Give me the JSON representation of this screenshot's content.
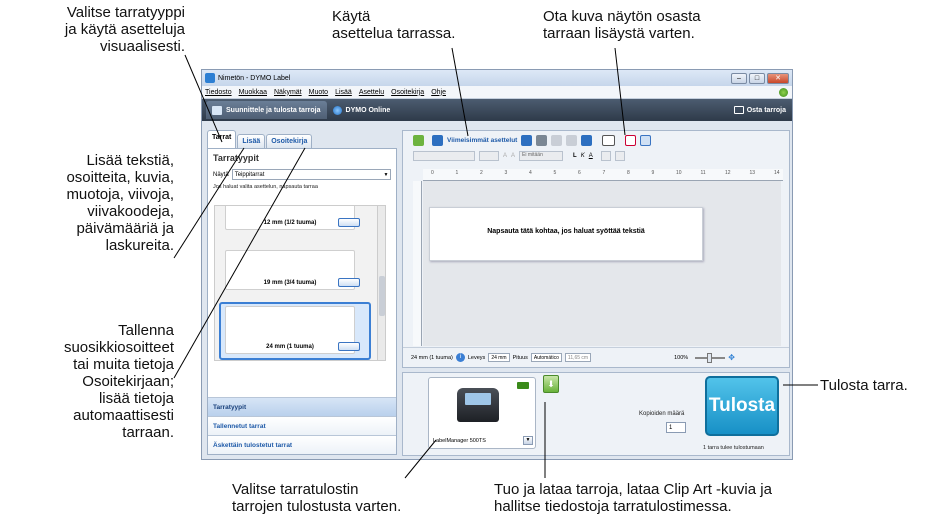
{
  "annotations": {
    "select_label_type": [
      "Valitse tarratyyppi",
      "ja käytä asetteluja",
      "visuaalisesti."
    ],
    "use_layout": [
      "Käytä",
      "asettelua tarrassa."
    ],
    "screen_capture": [
      "Ota kuva näytön osasta",
      "tarraan lisäystä varten."
    ],
    "insert_items": [
      "Lisää tekstiä,",
      "osoitteita, kuvia,",
      "muotoja, viivoja,",
      "viivakoodeja,",
      "päivämääriä ja",
      "laskureita."
    ],
    "save_addresses": [
      "Tallenna",
      "suosikkiosoitteet",
      "tai muita tietoja",
      "Osoitekirjaan;",
      "lisää tietoja",
      "automaattisesti",
      "tarraan."
    ],
    "print_label": [
      "Tulosta tarra."
    ],
    "select_printer": [
      "Valitse tarratulostin",
      "tarrojen tulostusta varten."
    ],
    "import_download": [
      "Tuo ja lataa tarroja, lataa Clip Art -kuvia ja",
      "hallitse tiedostoja tarratulostimessa."
    ]
  },
  "window": {
    "title": "Nimetön - DYMO Label",
    "menu": [
      "Tiedosto",
      "Muokkaa",
      "Näkymät",
      "Muoto",
      "Lisää",
      "Asettelu",
      "Osoitekirja",
      "Ohje"
    ],
    "app_tabs": [
      "Suunnittele ja tulosta tarroja",
      "DYMO Online"
    ],
    "buy_labels": "Osta tarroja"
  },
  "left_panel": {
    "tabs": [
      "Tarrat",
      "Lisää",
      "Osoitekirja"
    ],
    "heading": "Tarratyypit",
    "show_label": "Näytä",
    "show_value": "Teippitarrat",
    "hint": "Jos haluat valita asettelun, napsauta tarraa",
    "labels": [
      "12 mm (1/2 tuuma)",
      "19 mm (3/4 tuuma)",
      "24 mm (1 tuuma)"
    ],
    "sections": [
      "Tarratyypit",
      "Tallennetut tarrat",
      "Äskettäin tulostetut tarrat"
    ]
  },
  "editor": {
    "recent_layouts": "Viimeisimmät asettelut",
    "none_option": "Ei mitään",
    "ruler_ticks": [
      "0",
      "1",
      "2",
      "3",
      "4",
      "5",
      "6",
      "7",
      "8",
      "9",
      "10",
      "11",
      "12",
      "13",
      "14"
    ],
    "placeholder": "Napsauta tätä kohtaa, jos haluat syöttää tekstiä",
    "status": {
      "size": "24 mm (1 tuuma)",
      "width_label": "Leveys",
      "width_value": "24 mm",
      "length_label": "Pituus",
      "length_value": "Automático",
      "length_mm": "11,65 cm",
      "zoom": "100%"
    }
  },
  "bottom": {
    "printer": "LabelManager 500TS",
    "copies_label": "Kopioiden määrä",
    "copies_value": "1",
    "print_button": "Tulosta",
    "print_status": "1 tarra tulee tulostumaan"
  }
}
